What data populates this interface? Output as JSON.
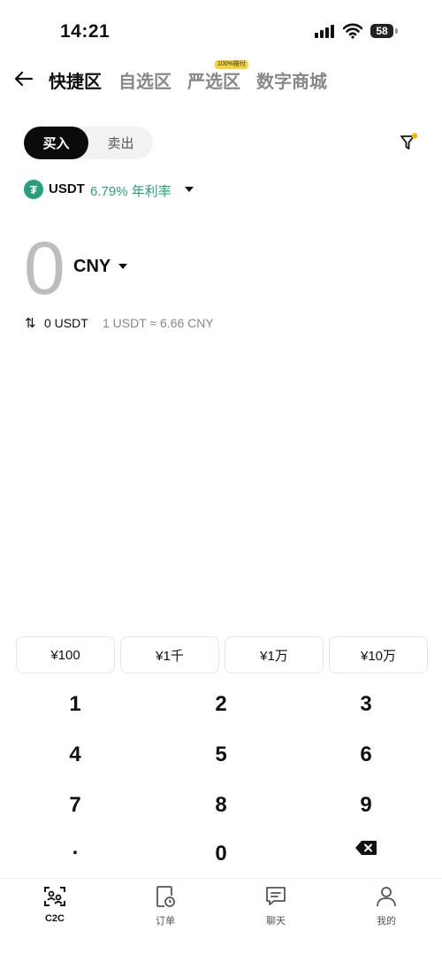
{
  "status_bar": {
    "time": "14:21",
    "battery": "58"
  },
  "nav": {
    "tabs": [
      {
        "label": "快捷区",
        "active": true
      },
      {
        "label": "自选区",
        "active": false
      },
      {
        "label": "严选区",
        "active": false
      },
      {
        "label": "数字商城",
        "active": false
      }
    ],
    "badge": "100%赔付"
  },
  "trade": {
    "buy_label": "买入",
    "sell_label": "卖出"
  },
  "coin": {
    "symbol": "USDT",
    "rate_text": "6.79% 年利率",
    "icon_glyph": "₮"
  },
  "amount": {
    "value": "0",
    "currency": "CNY"
  },
  "conversion": {
    "amount_text": "0 USDT",
    "rate_text": "1 USDT ≈ 6.66 CNY"
  },
  "quick_amounts": [
    "¥100",
    "¥1千",
    "¥1万",
    "¥10万"
  ],
  "keypad": [
    "1",
    "2",
    "3",
    "4",
    "5",
    "6",
    "7",
    "8",
    "9",
    ".",
    "0"
  ],
  "tabbar": [
    {
      "label": "C2C",
      "icon": "c2c-icon",
      "active": true
    },
    {
      "label": "订单",
      "icon": "order-icon",
      "active": false
    },
    {
      "label": "聊天",
      "icon": "chat-icon",
      "active": false
    },
    {
      "label": "我的",
      "icon": "profile-icon",
      "active": false
    }
  ],
  "colors": {
    "accent_green": "#26a17b",
    "primary": "#0b0b0b",
    "badge_yellow": "#f5d33a",
    "filter_dot": "#f5b700"
  }
}
